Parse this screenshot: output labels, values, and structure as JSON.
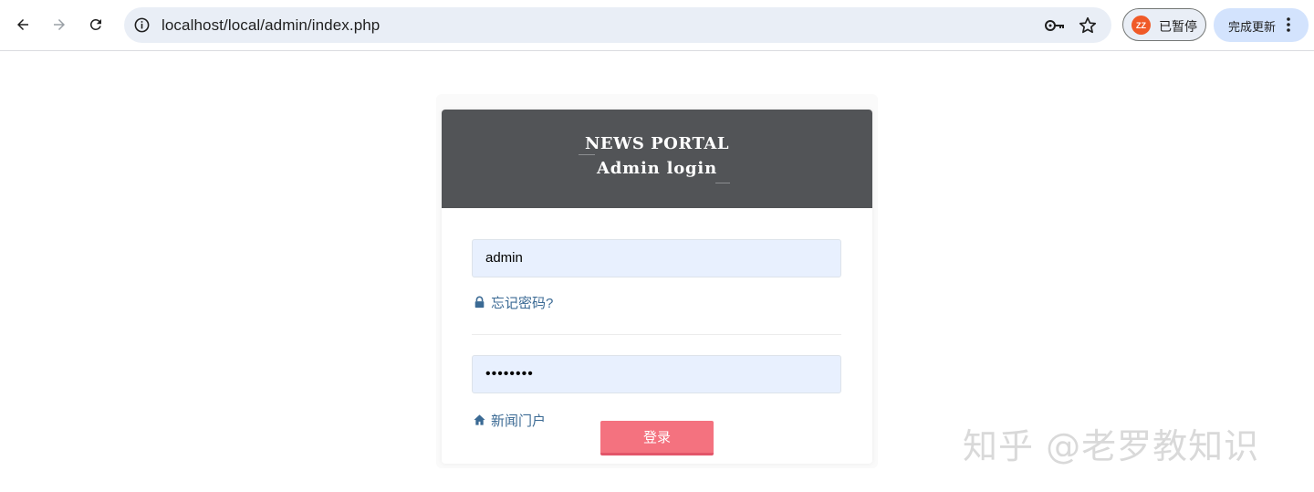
{
  "browser": {
    "url": "localhost/local/admin/index.php",
    "profile_initials": "ZZ",
    "profile_status": "已暂停",
    "update_label": "完成更新"
  },
  "login": {
    "brand_title": "NEWS PORTAL",
    "brand_subtitle": "Admin login",
    "username_value": "admin",
    "password_value": "••••••••",
    "forgot_link": "忘记密码?",
    "home_link": "新闻门户",
    "submit_label": "登录"
  },
  "watermark": "知乎 @老罗教知识",
  "colors": {
    "header_bg": "#525457",
    "button_bg": "#f4727f",
    "link": "#3b6a94",
    "input_bg": "#e8f0fe"
  }
}
